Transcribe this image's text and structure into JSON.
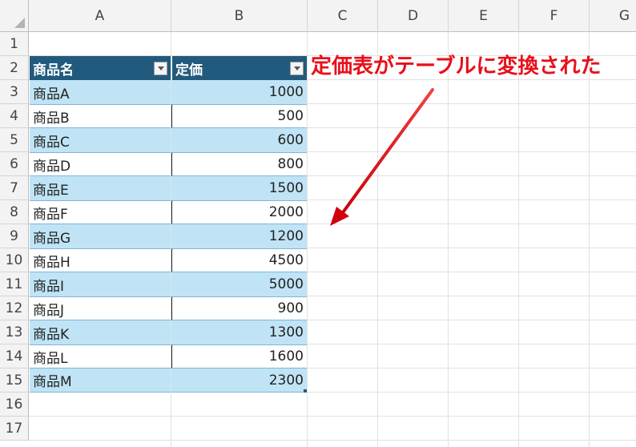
{
  "columns": [
    "A",
    "B",
    "C",
    "D",
    "E",
    "F",
    "G"
  ],
  "rows": [
    "1",
    "2",
    "3",
    "4",
    "5",
    "6",
    "7",
    "8",
    "9",
    "10",
    "11",
    "12",
    "13",
    "14",
    "15",
    "16",
    "17"
  ],
  "table": {
    "headers": [
      "商品名",
      "定価"
    ],
    "rows": [
      {
        "name": "商品A",
        "price": "1000"
      },
      {
        "name": "商品B",
        "price": "500"
      },
      {
        "name": "商品C",
        "price": "600"
      },
      {
        "name": "商品D",
        "price": "800"
      },
      {
        "name": "商品E",
        "price": "1500"
      },
      {
        "name": "商品F",
        "price": "2000"
      },
      {
        "name": "商品G",
        "price": "1200"
      },
      {
        "name": "商品H",
        "price": "4500"
      },
      {
        "name": "商品I",
        "price": "5000"
      },
      {
        "name": "商品J",
        "price": "900"
      },
      {
        "name": "商品K",
        "price": "1300"
      },
      {
        "name": "商品L",
        "price": "1600"
      },
      {
        "name": "商品M",
        "price": "2300"
      }
    ]
  },
  "annotation": {
    "text": "定価表がテーブルに変換された",
    "color": "#e8101a"
  },
  "colors": {
    "header_fill": "#215a7d",
    "band_fill": "#c0e4f5"
  },
  "icons": {
    "filter": "filter-dropdown-icon",
    "corner": "select-all-icon",
    "arrow": "arrow-icon"
  }
}
